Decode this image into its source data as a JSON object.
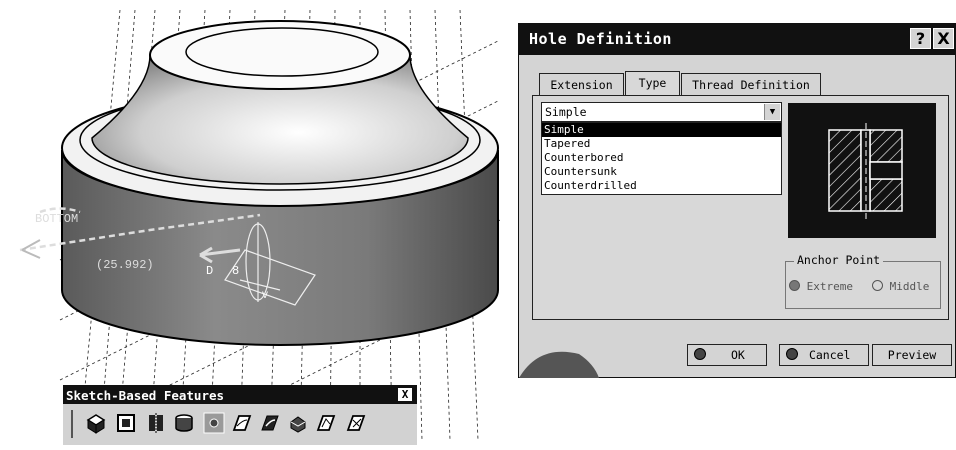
{
  "viewport": {
    "label_bottom": "BOTTOM",
    "dimension": "(25.992)",
    "label_d": "D",
    "label_8": "8",
    "label_v": "V"
  },
  "dialog": {
    "title": "Hole Definition",
    "help_label": "?",
    "close_label": "X",
    "tabs": [
      "Extension",
      "Type",
      "Thread Definition"
    ],
    "type_selected": "Simple",
    "type_options": [
      "Simple",
      "Tapered",
      "Counterbored",
      "Countersunk",
      "Counterdrilled"
    ],
    "anchor_legend": "Anchor Point",
    "anchor_extreme": "Extreme",
    "anchor_middle": "Middle",
    "ok": "OK",
    "cancel": "Cancel",
    "preview": "Preview"
  },
  "toolbar": {
    "title": "Sketch-Based Features",
    "close_label": "X",
    "icons": [
      "pad-icon",
      "pocket-icon",
      "shaft-icon",
      "groove-icon",
      "hole-icon",
      "rib-icon",
      "slot-icon",
      "stiffener-icon",
      "multi-section-solid-icon",
      "removed-multi-section-icon"
    ]
  }
}
